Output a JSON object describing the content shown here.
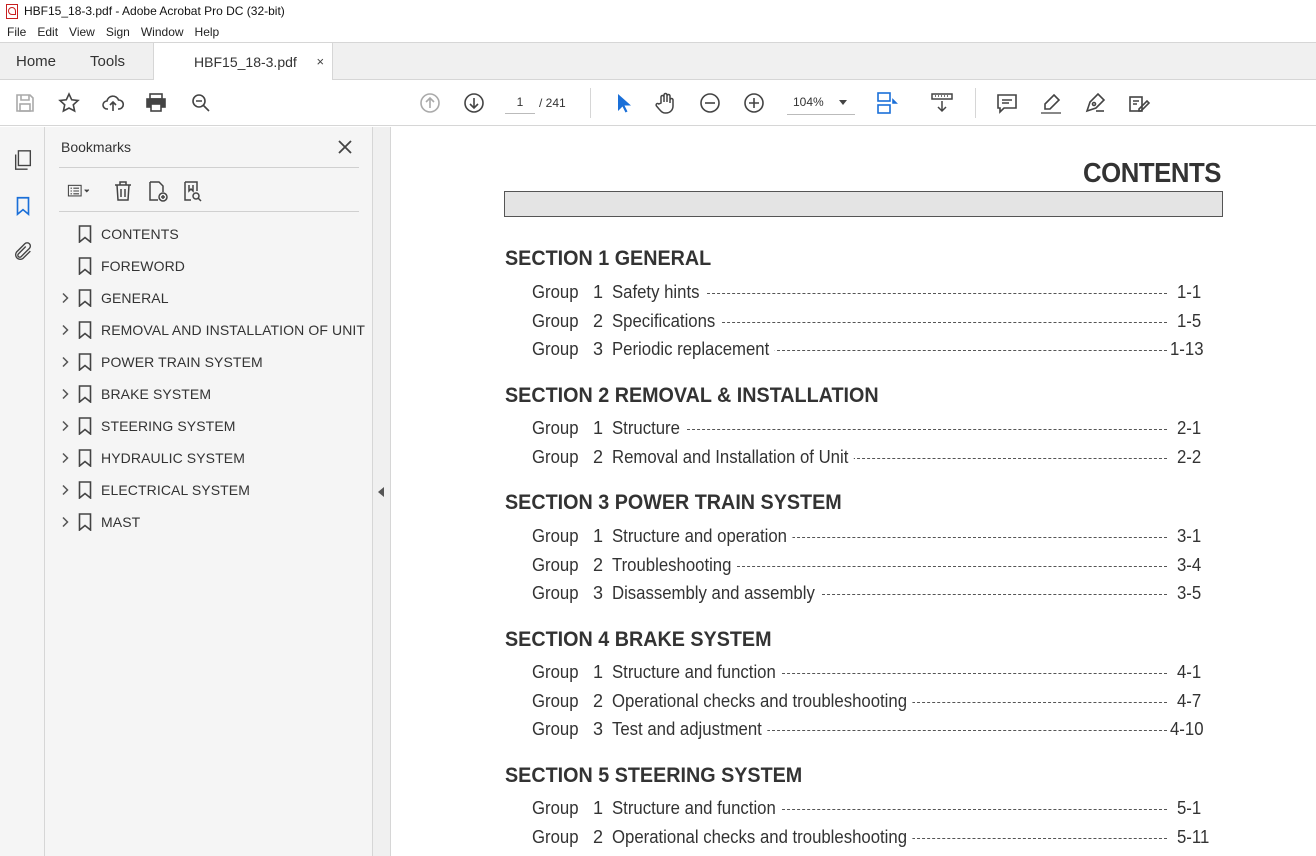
{
  "window": {
    "title": "HBF15_18-3.pdf - Adobe Acrobat Pro DC (32-bit)"
  },
  "menu": [
    "File",
    "Edit",
    "View",
    "Sign",
    "Window",
    "Help"
  ],
  "tabs": {
    "home": "Home",
    "tools": "Tools",
    "document": "HBF15_18-3.pdf",
    "close_glyph": "×"
  },
  "toolbar": {
    "page_current": "1",
    "page_total": "/ 241",
    "zoom": "104%"
  },
  "bookmarks": {
    "title": "Bookmarks",
    "items": [
      {
        "label": "CONTENTS",
        "expandable": false
      },
      {
        "label": "FOREWORD",
        "expandable": false
      },
      {
        "label": "GENERAL",
        "expandable": true
      },
      {
        "label": "REMOVAL AND INSTALLATION OF UNIT",
        "expandable": true
      },
      {
        "label": "POWER TRAIN SYSTEM",
        "expandable": true
      },
      {
        "label": "BRAKE SYSTEM",
        "expandable": true
      },
      {
        "label": "STEERING SYSTEM",
        "expandable": true
      },
      {
        "label": "HYDRAULIC SYSTEM",
        "expandable": true
      },
      {
        "label": "ELECTRICAL SYSTEM",
        "expandable": true
      },
      {
        "label": "MAST",
        "expandable": true
      }
    ]
  },
  "document": {
    "heading": "CONTENTS",
    "sections": [
      {
        "title": "SECTION 1  GENERAL",
        "groups": [
          {
            "group": "Group",
            "num": "1",
            "title": "Safety hints",
            "page": "1-1"
          },
          {
            "group": "Group",
            "num": "2",
            "title": "Specifications",
            "page": "1-5"
          },
          {
            "group": "Group",
            "num": "3",
            "title": "Periodic replacement",
            "page": "1-13"
          }
        ]
      },
      {
        "title": "SECTION 2  REMOVAL & INSTALLATION",
        "groups": [
          {
            "group": "Group",
            "num": "1",
            "title": "Structure",
            "page": "2-1"
          },
          {
            "group": "Group",
            "num": "2",
            "title": "Removal and Installation of Unit",
            "page": "2-2"
          }
        ]
      },
      {
        "title": "SECTION 3  POWER TRAIN SYSTEM",
        "groups": [
          {
            "group": "Group",
            "num": "1",
            "title": "Structure and operation",
            "page": "3-1"
          },
          {
            "group": "Group",
            "num": "2",
            "title": "Troubleshooting",
            "page": "3-4"
          },
          {
            "group": "Group",
            "num": "3",
            "title": "Disassembly and assembly",
            "page": "3-5"
          }
        ]
      },
      {
        "title": "SECTION 4  BRAKE SYSTEM",
        "groups": [
          {
            "group": "Group",
            "num": "1",
            "title": "Structure and function",
            "page": "4-1"
          },
          {
            "group": "Group",
            "num": "2",
            "title": "Operational checks and troubleshooting",
            "page": "4-7"
          },
          {
            "group": "Group",
            "num": "3",
            "title": "Test and adjustment",
            "page": "4-10"
          }
        ]
      },
      {
        "title": "SECTION 5  STEERING SYSTEM",
        "groups": [
          {
            "group": "Group",
            "num": "1",
            "title": "Structure and function",
            "page": "5-1"
          },
          {
            "group": "Group",
            "num": "2",
            "title": "Operational checks and troubleshooting",
            "page": "5-11"
          }
        ]
      }
    ]
  }
}
